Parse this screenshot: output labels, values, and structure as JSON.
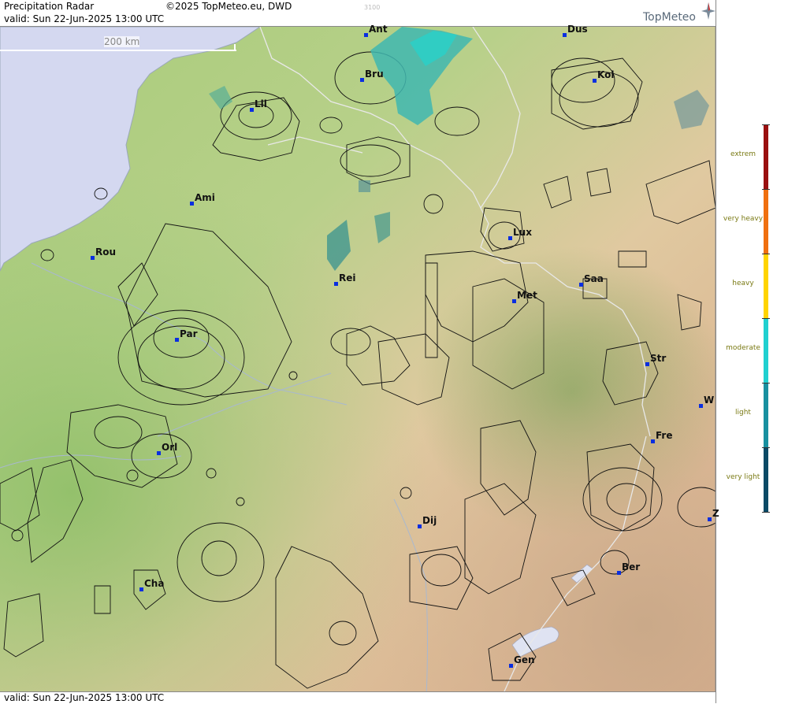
{
  "header": {
    "title": "Precipitation Radar",
    "valid_prefix": "valid:",
    "valid_time": "Sun  22-Jun-2025 13:00 UTC",
    "copyright": "©2025 TopMeteo.eu, DWD",
    "code": "3100"
  },
  "brand": {
    "name": "TopMeteo"
  },
  "footer": {
    "valid_prefix": "valid:",
    "valid_time": "Sun  22-Jun-2025 13:00 UTC"
  },
  "scale": {
    "label": "200 km"
  },
  "legend": {
    "items": [
      {
        "label": "extrem",
        "color": "#9a1010"
      },
      {
        "label": "very heavy",
        "color": "#f07010"
      },
      {
        "label": "heavy",
        "color": "#ffd400"
      },
      {
        "label": "moderate",
        "color": "#20d0d0"
      },
      {
        "label": "light",
        "color": "#1890a0"
      },
      {
        "label": "very light",
        "color": "#0a4a66"
      }
    ]
  },
  "cities": [
    {
      "label": "Ant"
    },
    {
      "label": "Dus"
    },
    {
      "label": "Bru"
    },
    {
      "label": "Kol"
    },
    {
      "label": "Lil"
    },
    {
      "label": "Ami"
    },
    {
      "label": "Rou"
    },
    {
      "label": "Lux"
    },
    {
      "label": "Rei"
    },
    {
      "label": "Saa"
    },
    {
      "label": "Met"
    },
    {
      "label": "Par"
    },
    {
      "label": "Str"
    },
    {
      "label": "W"
    },
    {
      "label": "Fre"
    },
    {
      "label": "Orl"
    },
    {
      "label": "Dij"
    },
    {
      "label": "Z"
    },
    {
      "label": "Ber"
    },
    {
      "label": "Cha"
    },
    {
      "label": "Gen"
    }
  ],
  "colors": {
    "sea": "#d4d8f0",
    "lowland": "#a8cc7a",
    "upland": "#e0c9a0",
    "mountain": "#d8a888",
    "city_dot": "#0a2ee0"
  }
}
